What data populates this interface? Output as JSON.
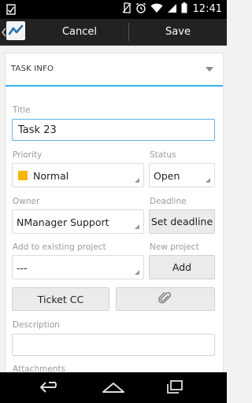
{
  "status_bar": {
    "time": "12:41",
    "icons": [
      "app-notification-icon",
      "no-sim-icon",
      "alarm-icon",
      "wifi-icon",
      "cell-signal-icon",
      "battery-icon"
    ]
  },
  "action_bar": {
    "cancel_label": "Cancel",
    "save_label": "Save",
    "app_icon": "app-logo-icon"
  },
  "section": {
    "title": "TASK INFO",
    "accent_color": "#33b5e5"
  },
  "form": {
    "title_label": "Title",
    "title_value": "Task 23",
    "priority_label": "Priority",
    "priority_value": "Normal",
    "priority_color": "#f7b500",
    "status_label": "Status",
    "status_value": "Open",
    "owner_label": "Owner",
    "owner_value": "NManager Support",
    "deadline_label": "Deadline",
    "set_deadline_label": "Set deadline",
    "project_label": "Add to existing project",
    "project_value": "---",
    "new_project_label": "New project",
    "add_label": "Add",
    "ticket_cc_label": "Ticket CC",
    "attach_icon": "paperclip-icon",
    "description_label": "Description",
    "description_value": "",
    "attachments_label": "Attachments"
  },
  "nav_bar": {
    "icons": [
      "back-icon",
      "home-icon",
      "recent-apps-icon"
    ]
  }
}
